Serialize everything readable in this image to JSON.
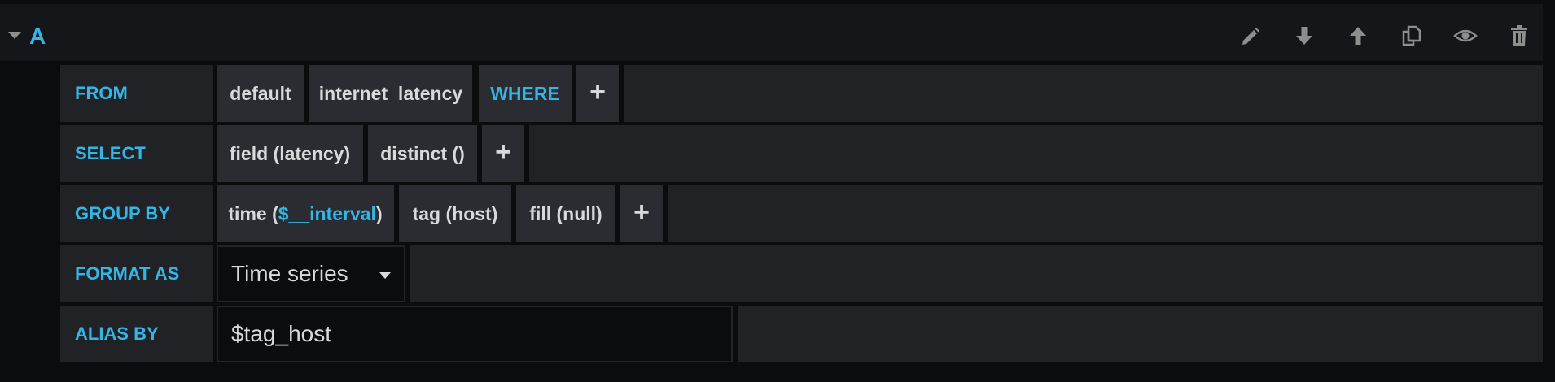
{
  "header": {
    "ref_id": "A",
    "toolbar": [
      "pencil-icon",
      "arrow-down-icon",
      "arrow-up-icon",
      "duplicate-icon",
      "eye-icon",
      "trash-icon"
    ]
  },
  "rows": {
    "from": {
      "label": "FROM",
      "policy": "default",
      "measurement": "internet_latency",
      "where": "WHERE",
      "add": "+"
    },
    "select": {
      "label": "SELECT",
      "field": "field (latency)",
      "func": "distinct ()",
      "add": "+"
    },
    "group_by": {
      "label": "GROUP BY",
      "time_prefix": "time (",
      "time_var": "$__interval",
      "time_suffix": ")",
      "tag": "tag (host)",
      "fill": "fill (null)",
      "add": "+"
    },
    "format_as": {
      "label": "FORMAT AS",
      "value": "Time series"
    },
    "alias_by": {
      "label": "ALIAS BY",
      "value": "$tag_host"
    }
  },
  "colors": {
    "accent": "#33b5e5",
    "segment_bg": "#2a2c31",
    "label_bg": "#202226",
    "text": "#d8d9da",
    "page_bg": "#0b0c0e"
  }
}
